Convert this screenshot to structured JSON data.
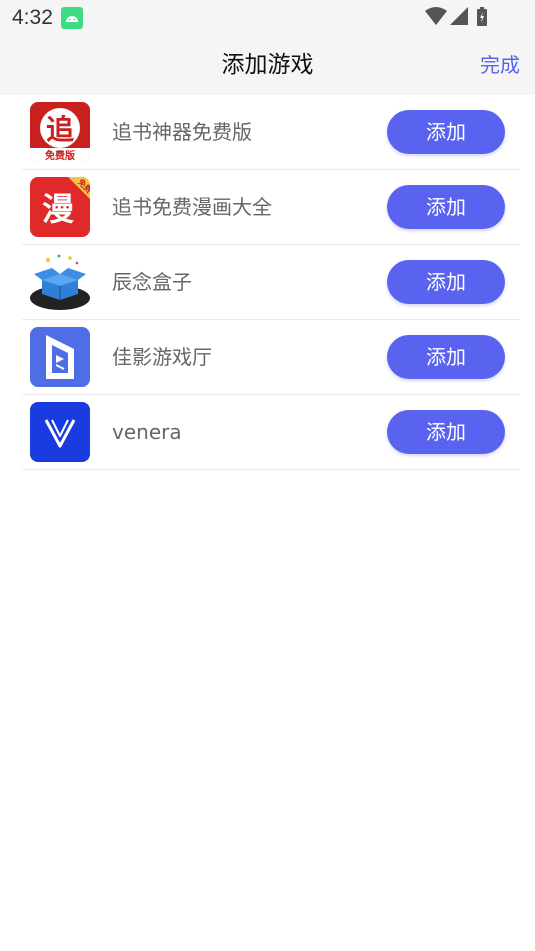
{
  "status_bar": {
    "time": "4:32"
  },
  "header": {
    "title": "添加游戏",
    "done_label": "完成"
  },
  "apps": [
    {
      "name": "追书神器免费版",
      "icon": "zhuishu-shenqi-icon",
      "icon_text": "追",
      "icon_badge": "免费版",
      "add_label": "添加"
    },
    {
      "name": "追书免费漫画大全",
      "icon": "zhuishu-manhua-icon",
      "icon_text": "漫",
      "icon_badge": "免费",
      "add_label": "添加"
    },
    {
      "name": "辰念盒子",
      "icon": "chennian-box-icon",
      "add_label": "添加"
    },
    {
      "name": "佳影游戏厅",
      "icon": "jiaying-icon",
      "add_label": "添加"
    },
    {
      "name": "venera",
      "icon": "venera-icon",
      "add_label": "添加"
    }
  ],
  "colors": {
    "accent": "#5a63f0",
    "header_bg": "#f5f5f5"
  }
}
